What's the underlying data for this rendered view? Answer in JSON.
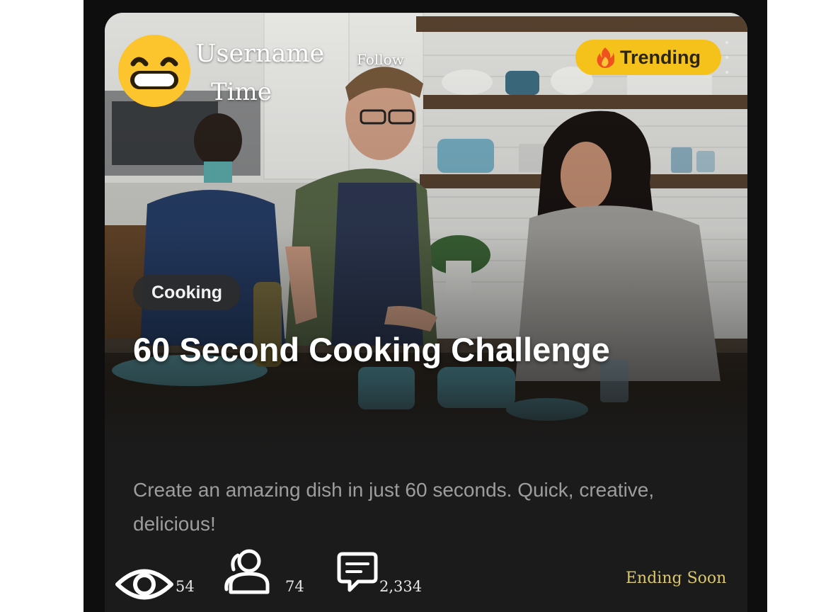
{
  "header": {
    "username": "Username",
    "time": "Time",
    "follow_label": "Follow",
    "avatar_icon": "grinning-face-emoji-icon"
  },
  "badge": {
    "label": "Trending",
    "icon": "fire-icon",
    "color": "#f5c21b"
  },
  "post": {
    "category": "Cooking",
    "title": "60 Second Cooking Challenge",
    "description": "Create an amazing dish in just 60 seconds. Quick, creative, delicious!"
  },
  "stats": {
    "views": "54",
    "participants": "74",
    "comments": "2,334",
    "status": "Ending Soon"
  },
  "icons": {
    "views": "eye-icon",
    "participants": "users-icon",
    "comments": "comment-icon",
    "menu": "more-vertical-icon"
  }
}
